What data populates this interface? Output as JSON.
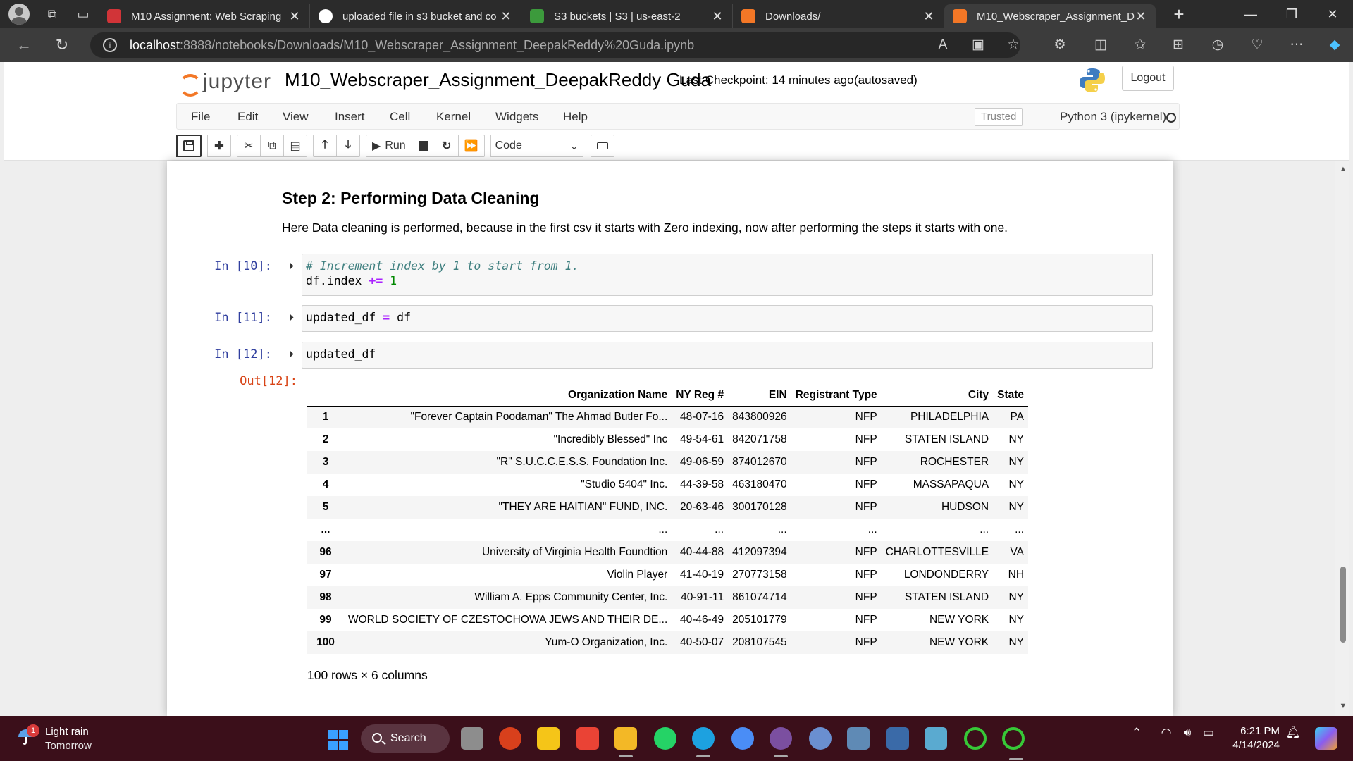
{
  "browser": {
    "tabs": [
      {
        "title": "M10 Assignment: Web Scraping",
        "color": "#d13438"
      },
      {
        "title": "uploaded file in s3 bucket and co",
        "color": "#ffffff"
      },
      {
        "title": "S3 buckets | S3 | us-east-2",
        "color": "#3c9a3c"
      },
      {
        "title": "Downloads/",
        "color": "#f37726"
      },
      {
        "title": "M10_Webscraper_Assignment_D",
        "color": "#f37726"
      }
    ],
    "url_host": "localhost",
    "url_path": ":8888/notebooks/Downloads/M10_Webscraper_Assignment_DeepakReddy%20Guda.ipynb"
  },
  "jupyter": {
    "logo_text": "jupyter",
    "notebook_title": "M10_Webscraper_Assignment_DeepakReddy Guda",
    "checkpoint": "Last Checkpoint: 14 minutes ago",
    "autosaved": "(autosaved)",
    "logout": "Logout",
    "menu": [
      "File",
      "Edit",
      "View",
      "Insert",
      "Cell",
      "Kernel",
      "Widgets",
      "Help"
    ],
    "trusted": "Trusted",
    "kernel": "Python 3 (ipykernel)",
    "run_label": "Run",
    "cell_type": "Code"
  },
  "cells": {
    "heading": "Step 2: Performing Data Cleaning",
    "paragraph": "Here Data cleaning is performed, because in the first csv it starts with Zero indexing, now after performing the steps it starts with one.",
    "c10_prompt": "In [10]:",
    "c10_comment": "# Increment index by 1 to start from 1.",
    "c10_code_a": "df.index ",
    "c10_op": "+=",
    "c10_num": " 1",
    "c11_prompt": "In [11]:",
    "c11_code_a": "updated_df ",
    "c11_op": "=",
    "c11_code_b": " df",
    "c12_prompt": "In [12]:",
    "c12_code": "updated_df",
    "out_prompt": "Out[12]:",
    "rows_info": "100 rows × 6 columns"
  },
  "table": {
    "columns": [
      "",
      "Organization Name",
      "NY Reg #",
      "EIN",
      "Registrant Type",
      "City",
      "State"
    ],
    "rows": [
      [
        "1",
        "\"Forever Captain Poodaman\" The Ahmad Butler Fo...",
        "48-07-16",
        "843800926",
        "NFP",
        "PHILADELPHIA",
        "PA"
      ],
      [
        "2",
        "\"Incredibly Blessed\" Inc",
        "49-54-61",
        "842071758",
        "NFP",
        "STATEN ISLAND",
        "NY"
      ],
      [
        "3",
        "\"R\" S.U.C.C.E.S.S. Foundation Inc.",
        "49-06-59",
        "874012670",
        "NFP",
        "ROCHESTER",
        "NY"
      ],
      [
        "4",
        "\"Studio 5404\" Inc.",
        "44-39-58",
        "463180470",
        "NFP",
        "MASSAPAQUA",
        "NY"
      ],
      [
        "5",
        "\"THEY ARE HAITIAN\" FUND, INC.",
        "20-63-46",
        "300170128",
        "NFP",
        "HUDSON",
        "NY"
      ],
      [
        "...",
        "...",
        "...",
        "...",
        "...",
        "...",
        "..."
      ],
      [
        "96",
        "University of Virginia Health Foundtion",
        "40-44-88",
        "412097394",
        "NFP",
        "CHARLOTTESVILLE",
        "VA"
      ],
      [
        "97",
        "Violin Player",
        "41-40-19",
        "270773158",
        "NFP",
        "LONDONDERRY",
        "NH"
      ],
      [
        "98",
        "William A. Epps Community Center, Inc.",
        "40-91-11",
        "861074714",
        "NFP",
        "STATEN ISLAND",
        "NY"
      ],
      [
        "99",
        "WORLD SOCIETY OF CZESTOCHOWA JEWS AND THEIR DE...",
        "40-46-49",
        "205101779",
        "NFP",
        "NEW YORK",
        "NY"
      ],
      [
        "100",
        "Yum-O Organization, Inc.",
        "40-50-07",
        "208107545",
        "NFP",
        "NEW YORK",
        "NY"
      ]
    ]
  },
  "taskbar": {
    "weather_badge": "1",
    "weather_line1": "Light rain",
    "weather_line2": "Tomorrow",
    "search": "Search",
    "time": "6:21 PM",
    "date": "4/14/2024"
  }
}
